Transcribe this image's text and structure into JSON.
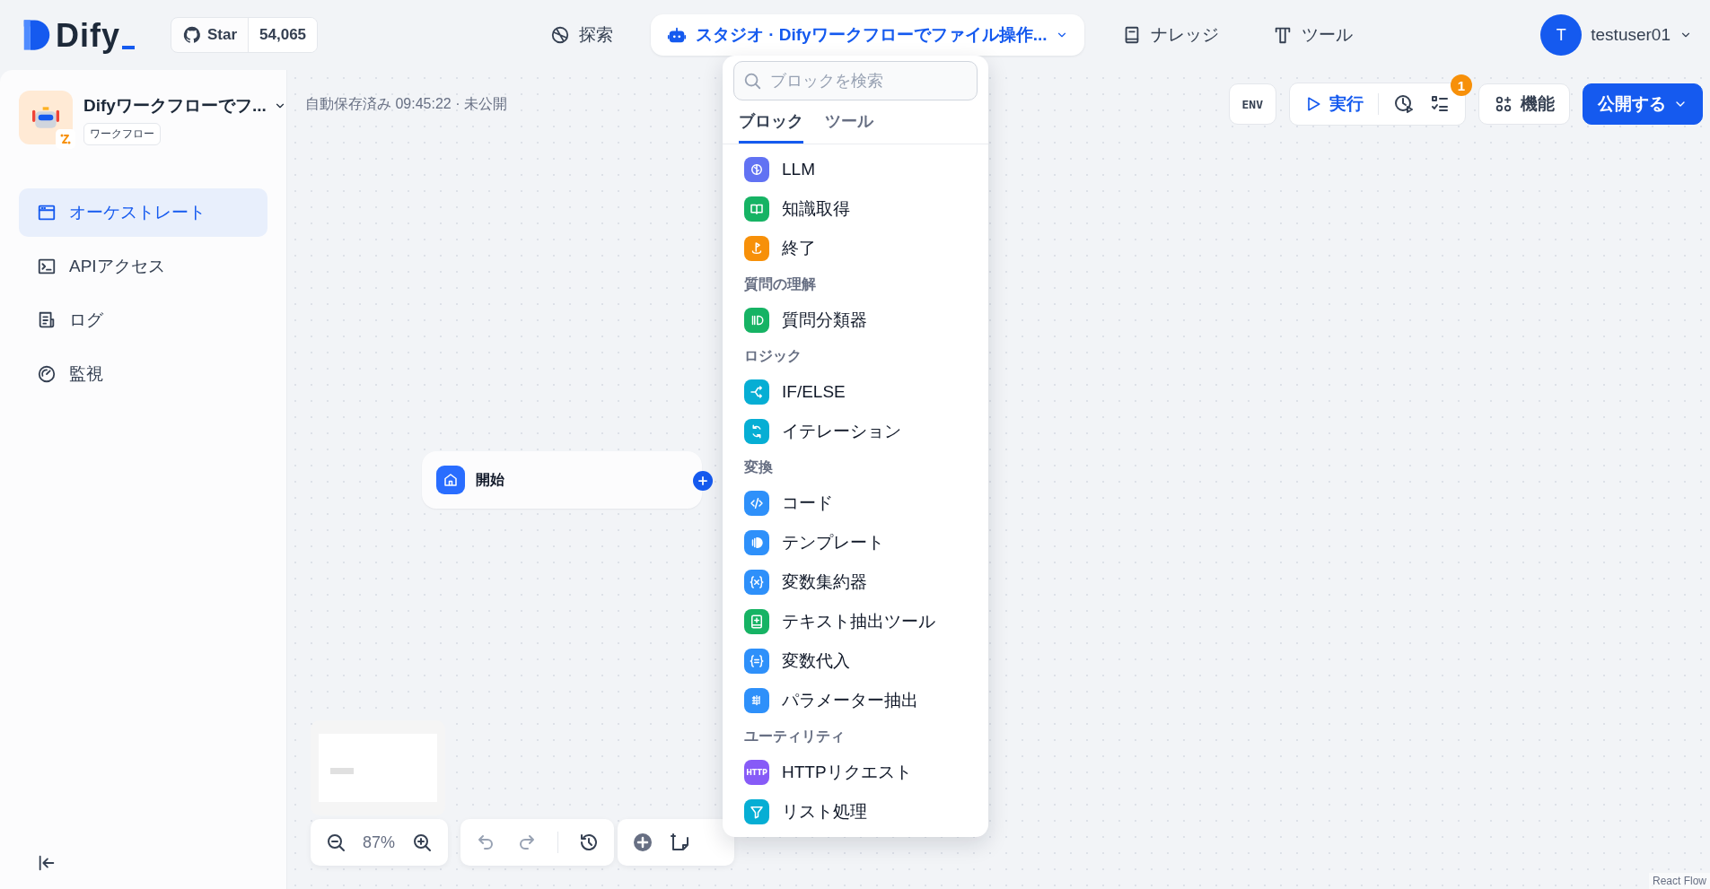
{
  "header": {
    "logo": "Dify",
    "github": {
      "label": "Star",
      "count": "54,065"
    },
    "nav": [
      {
        "label": "探索",
        "kind": "compass",
        "selected": false
      },
      {
        "label": "スタジオ · Difyワークフローでファイル操作...",
        "kind": "robot",
        "selected": true
      },
      {
        "label": "ナレッジ",
        "kind": "book",
        "selected": false
      },
      {
        "label": "ツール",
        "kind": "tool",
        "selected": false
      }
    ],
    "user": {
      "initial": "T",
      "name": "testuser01"
    }
  },
  "sidebar": {
    "app_name": "Difyワークフローでフ...",
    "app_type": "ワークフロー",
    "items": [
      {
        "label": "オーケストレート",
        "kind": "window",
        "selected": true
      },
      {
        "label": "APIアクセス",
        "kind": "terminal",
        "selected": false
      },
      {
        "label": "ログ",
        "kind": "log",
        "selected": false
      },
      {
        "label": "監視",
        "kind": "gauge",
        "selected": false
      }
    ]
  },
  "canvas": {
    "autosave": "自動保存済み 09:45:22 · 未公開",
    "toolbar": {
      "env": "ENV",
      "run": "実行",
      "checklist_badge": "1",
      "features": "機能",
      "publish": "公開する"
    },
    "start_node": {
      "label": "開始"
    },
    "zoom": "87%",
    "attribution": "React Flow"
  },
  "block_menu": {
    "search": {
      "placeholder": "ブロックを検索"
    },
    "tabs": [
      {
        "label": "ブロック",
        "selected": true
      },
      {
        "label": "ツール",
        "selected": false
      }
    ],
    "sections": [
      {
        "items": [
          {
            "label": "LLM",
            "kind": "llm",
            "color": "#6172f3"
          },
          {
            "label": "知識取得",
            "kind": "knowledge",
            "color": "#16b364"
          },
          {
            "label": "終了",
            "kind": "end",
            "color": "#f79009"
          }
        ]
      },
      {
        "title": "質問の理解",
        "items": [
          {
            "label": "質問分類器",
            "kind": "classifier",
            "color": "#16b364"
          }
        ]
      },
      {
        "title": "ロジック",
        "items": [
          {
            "label": "IF/ELSE",
            "kind": "ifelse",
            "color": "#06aed4"
          },
          {
            "label": "イテレーション",
            "kind": "iteration",
            "color": "#06aed4"
          }
        ]
      },
      {
        "title": "変換",
        "items": [
          {
            "label": "コード",
            "kind": "code",
            "color": "#2e90fa"
          },
          {
            "label": "テンプレート",
            "kind": "template",
            "color": "#2e90fa"
          },
          {
            "label": "変数集約器",
            "kind": "aggregator",
            "color": "#2e90fa"
          },
          {
            "label": "テキスト抽出ツール",
            "kind": "extractor",
            "color": "#16b364"
          },
          {
            "label": "変数代入",
            "kind": "assigner",
            "color": "#2e90fa"
          },
          {
            "label": "パラメーター抽出",
            "kind": "parameter",
            "color": "#2e90fa"
          }
        ]
      },
      {
        "title": "ユーティリティ",
        "items": [
          {
            "label": "HTTPリクエスト",
            "kind": "http",
            "color": "#875bf7",
            "badge": "HTTP"
          },
          {
            "label": "リスト処理",
            "kind": "list",
            "color": "#06aed4"
          }
        ]
      }
    ]
  }
}
